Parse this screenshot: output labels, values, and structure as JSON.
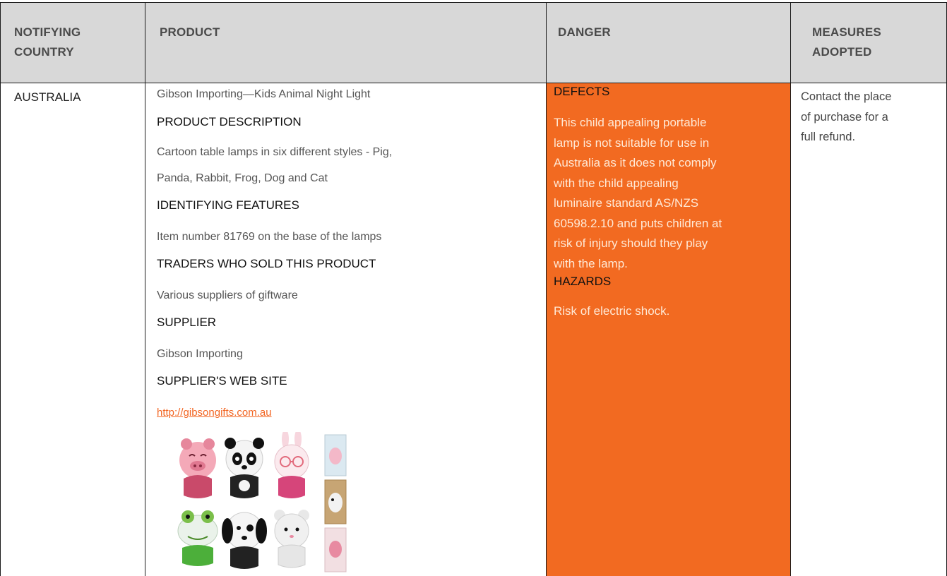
{
  "headers": {
    "country_line1": "NOTIFYING",
    "country_line2": "COUNTRY",
    "product": "PRODUCT",
    "danger": "DANGER",
    "measures_line1": "MEASURES",
    "measures_line2": "ADOPTED"
  },
  "row": {
    "country": "AUSTRALIA",
    "product": {
      "title": "Gibson Importing—Kids Animal Night Light",
      "desc_heading": "PRODUCT DESCRIPTION",
      "desc_line1": "Cartoon table lamps in six different styles - Pig,",
      "desc_line2": "Panda, Rabbit, Frog, Dog and Cat",
      "features_heading": "IDENTIFYING FEATURES",
      "features_text": "Item number 81769 on the base of the lamps",
      "traders_heading": "TRADERS WHO SOLD THIS PRODUCT",
      "traders_text": "Various suppliers of giftware",
      "supplier_heading": "SUPPLIER",
      "supplier_text": "Gibson Importing",
      "website_heading": "SUPPLIER'S WEB SITE",
      "website_url": "http://gibsongifts.com.au"
    },
    "danger": {
      "defects_heading": "DEFECTS",
      "defects_lines": [
        "This child appealing portable",
        "lamp is not suitable for use in",
        "Australia as it does not comply",
        "with the child appealing",
        "luminaire standard AS/NZS",
        "60598.2.10 and puts children at",
        "risk of injury should they play",
        "with the lamp."
      ],
      "hazards_heading": "HAZARDS",
      "hazards_text": "Risk of electric shock."
    },
    "measures_lines": [
      "Contact the place",
      "of purchase for a",
      "full refund."
    ]
  },
  "colors": {
    "header_bg": "#d8d8d8",
    "danger_bg": "#f26a21",
    "link": "#f26522"
  },
  "icons": [
    "pig-lamp-icon",
    "panda-lamp-icon",
    "rabbit-lamp-icon",
    "frog-lamp-icon",
    "dog-lamp-icon",
    "cat-lamp-icon",
    "lamp-box-icon"
  ]
}
